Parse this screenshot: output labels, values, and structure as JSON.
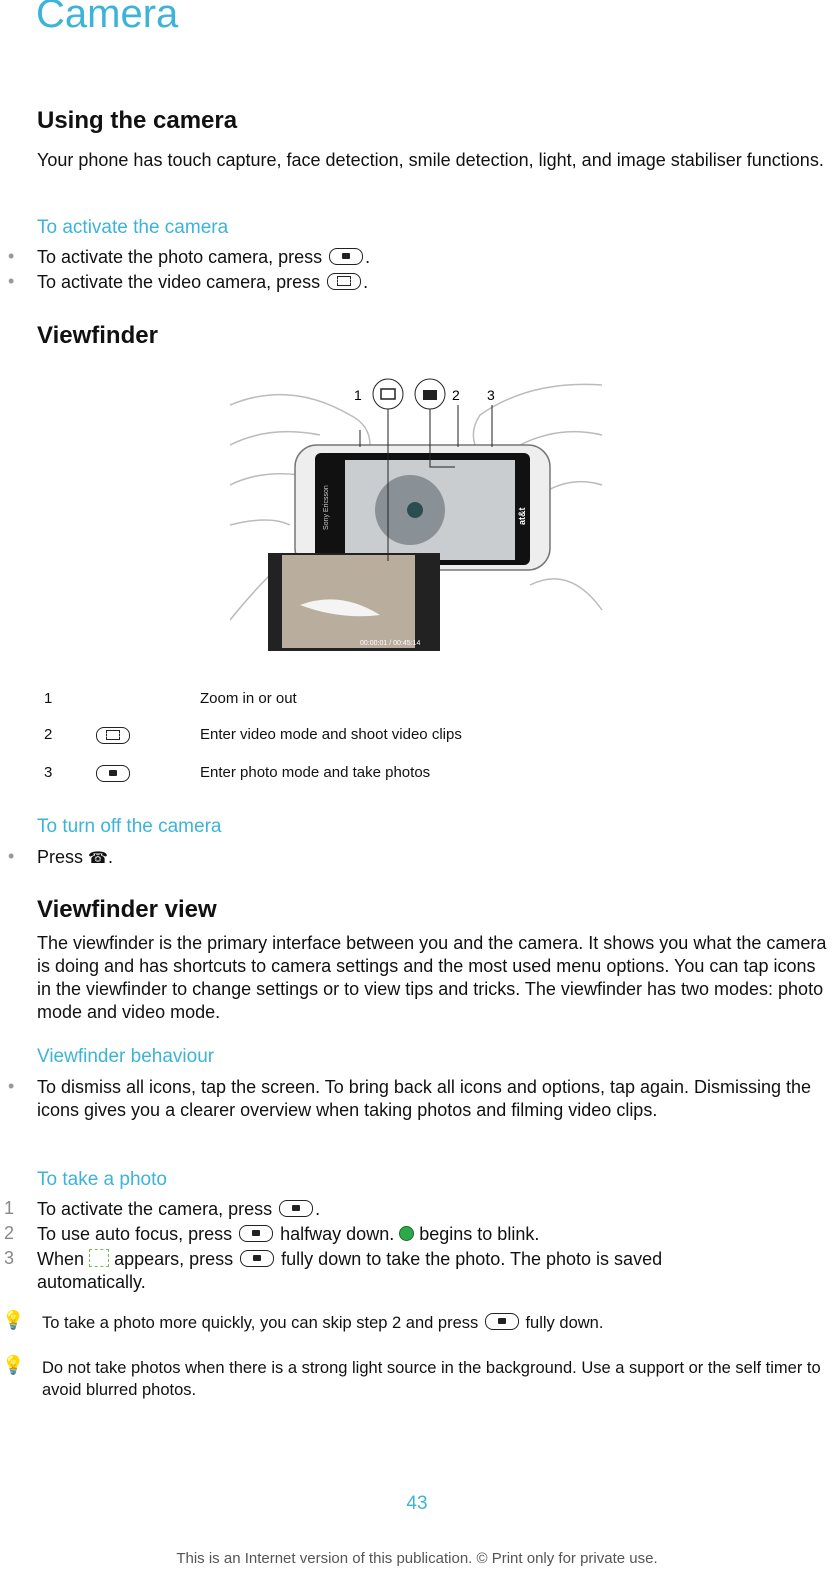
{
  "title": "Camera",
  "using": {
    "heading": "Using the camera",
    "text": "Your phone has touch capture, face detection, smile detection, light, and image stabiliser functions."
  },
  "activate": {
    "heading": "To activate the camera",
    "items": [
      "To activate the photo camera, press",
      "To activate the video camera, press"
    ]
  },
  "viewfinder": {
    "heading": "Viewfinder",
    "figure": {
      "callouts": [
        "1",
        "2",
        "3"
      ],
      "brand": "Sony Ericsson",
      "carrier": "at&t",
      "timer": "00:00:01 / 00:45:14"
    },
    "table": [
      {
        "num": "1",
        "icon": "",
        "text": "Zoom in or out"
      },
      {
        "num": "2",
        "icon": "video-key",
        "text": "Enter video mode and shoot video clips"
      },
      {
        "num": "3",
        "icon": "camera-key",
        "text": "Enter photo mode and take photos"
      }
    ]
  },
  "turn_off": {
    "heading": "To turn off the camera",
    "item": "Press"
  },
  "view": {
    "heading": "Viewfinder view",
    "text": "The viewfinder is the primary interface between you and the camera. It shows you what the camera is doing and has shortcuts to camera settings and the most used menu options. You can tap icons in the viewfinder to change settings or to view tips and tricks. The viewfinder has two modes: photo mode and video mode."
  },
  "behaviour": {
    "heading": "Viewfinder behaviour",
    "item": "To dismiss all icons, tap the screen. To bring back all icons and options, tap again. Dismissing the icons gives you a clearer overview when taking photos and filming video clips."
  },
  "take_photo": {
    "heading": "To take a photo",
    "steps": [
      {
        "n": "1",
        "a": "To activate the camera, press",
        "b": "."
      },
      {
        "n": "2",
        "a": "To use auto focus, press",
        "b": "halfway down.",
        "c": "begins to blink."
      },
      {
        "n": "3",
        "a": "When",
        "b": "appears, press",
        "c": "fully down to take the photo. The photo is saved automatically."
      }
    ]
  },
  "tips": [
    {
      "a": "To take a photo more quickly, you can skip step 2 and press",
      "b": "fully down."
    },
    {
      "a": "Do not take photos when there is a strong light source in the background. Use a support or the self timer to avoid blurred photos."
    }
  ],
  "page_number": "43",
  "footer": "This is an Internet version of this publication. © Print only for private use.",
  "colors": {
    "accent": "#3cb4d8",
    "focus_dot": "#2ea84a",
    "focus_frame": "#6cc24a"
  }
}
